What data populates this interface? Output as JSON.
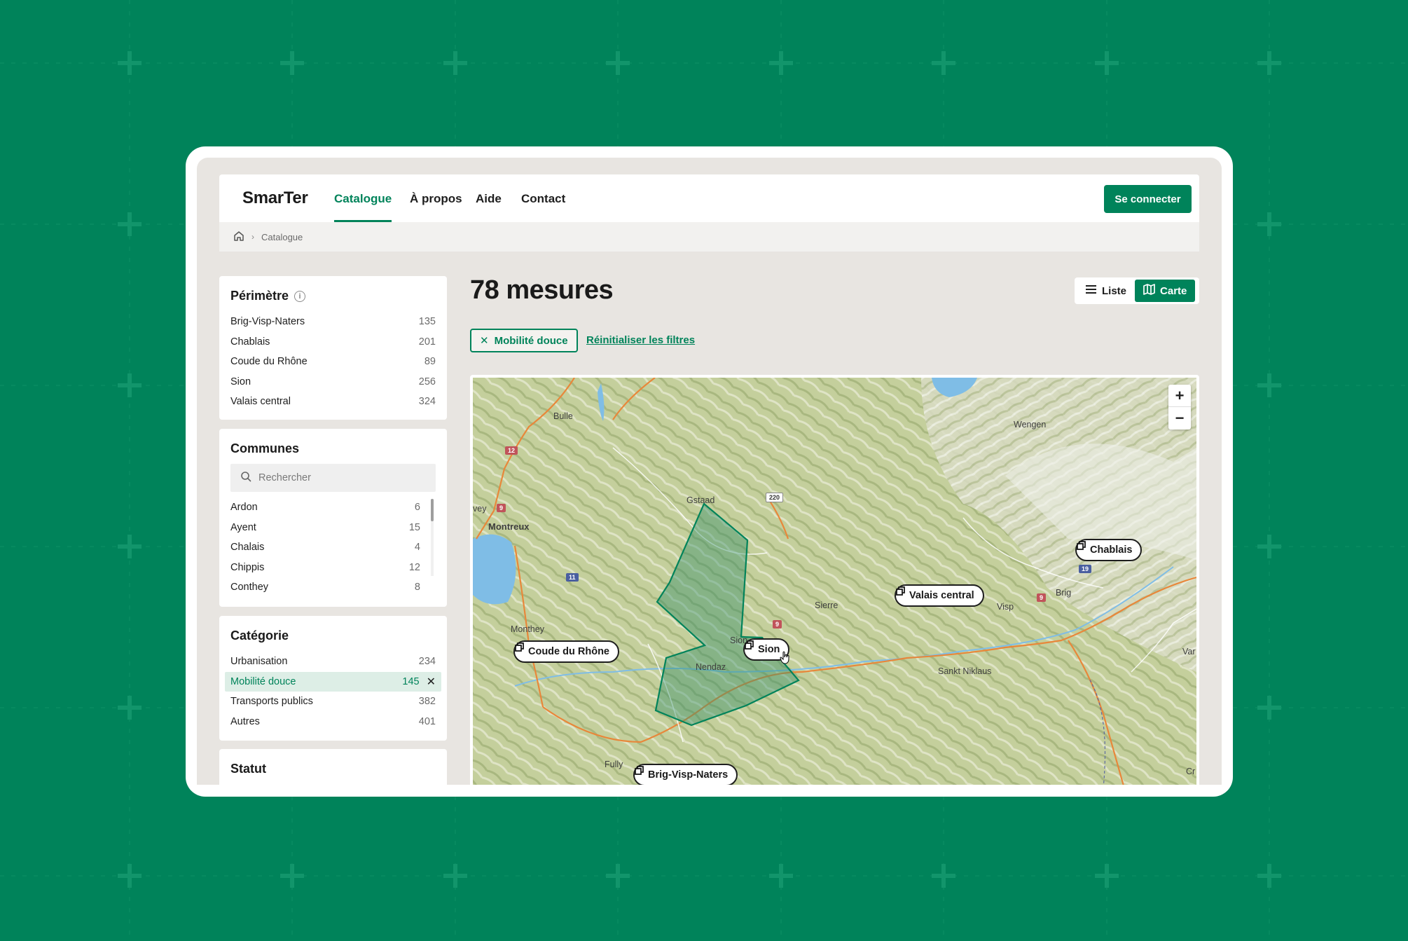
{
  "app": {
    "brand": "SmarTer"
  },
  "nav": {
    "items": [
      {
        "label": "Catalogue",
        "active": true
      },
      {
        "label": "À propos",
        "active": false
      },
      {
        "label": "Aide",
        "active": false
      },
      {
        "label": "Contact",
        "active": false
      }
    ],
    "login_label": "Se connecter"
  },
  "breadcrumb": {
    "current": "Catalogue"
  },
  "filters": {
    "perimetre": {
      "title": "Périmètre",
      "items": [
        {
          "label": "Brig-Visp-Naters",
          "count": "135"
        },
        {
          "label": "Chablais",
          "count": "201"
        },
        {
          "label": "Coude du Rhône",
          "count": "89"
        },
        {
          "label": "Sion",
          "count": "256"
        },
        {
          "label": "Valais central",
          "count": "324"
        }
      ]
    },
    "communes": {
      "title": "Communes",
      "search_placeholder": "Rechercher",
      "items": [
        {
          "label": "Ardon",
          "count": "6"
        },
        {
          "label": "Ayent",
          "count": "15"
        },
        {
          "label": "Chalais",
          "count": "4"
        },
        {
          "label": "Chippis",
          "count": "12"
        },
        {
          "label": "Conthey",
          "count": "8"
        }
      ]
    },
    "categorie": {
      "title": "Catégorie",
      "items": [
        {
          "label": "Urbanisation",
          "count": "234"
        },
        {
          "label": "Mobilité douce",
          "count": "145",
          "selected": true
        },
        {
          "label": "Transports publics",
          "count": "382"
        },
        {
          "label": "Autres",
          "count": "401"
        }
      ]
    },
    "statut": {
      "title": "Statut"
    }
  },
  "main": {
    "result_title": "78 mesures",
    "view_list_label": "Liste",
    "view_map_label": "Carte",
    "active_chip": "Mobilité douce",
    "reset_label": "Réinitialiser les filtres"
  },
  "map": {
    "zoom_in": "+",
    "zoom_out": "−",
    "regions": [
      {
        "label": "Chablais"
      },
      {
        "label": "Valais central"
      },
      {
        "label": "Sion"
      },
      {
        "label": "Coude du Rhône"
      },
      {
        "label": "Brig-Visp-Naters"
      }
    ],
    "places": [
      "Bulle",
      "Wengen",
      "Gstaad",
      "Montreux",
      "Sierre",
      "Brig",
      "Visp",
      "Monthey",
      "Sion",
      "Nendaz",
      "Sankt Niklaus",
      "Fully",
      "vey",
      "Var",
      "Cr"
    ],
    "road_numbers": [
      "12",
      "9",
      "220",
      "11",
      "19",
      "9",
      "9"
    ],
    "colors": {
      "highlight_fill": "#2f8c6a",
      "highlight_stroke": "#00835a",
      "road": "#e8873a"
    }
  },
  "colors": {
    "brand": "#00835a",
    "background": "#00835a",
    "screen": "#e8e5e1"
  }
}
